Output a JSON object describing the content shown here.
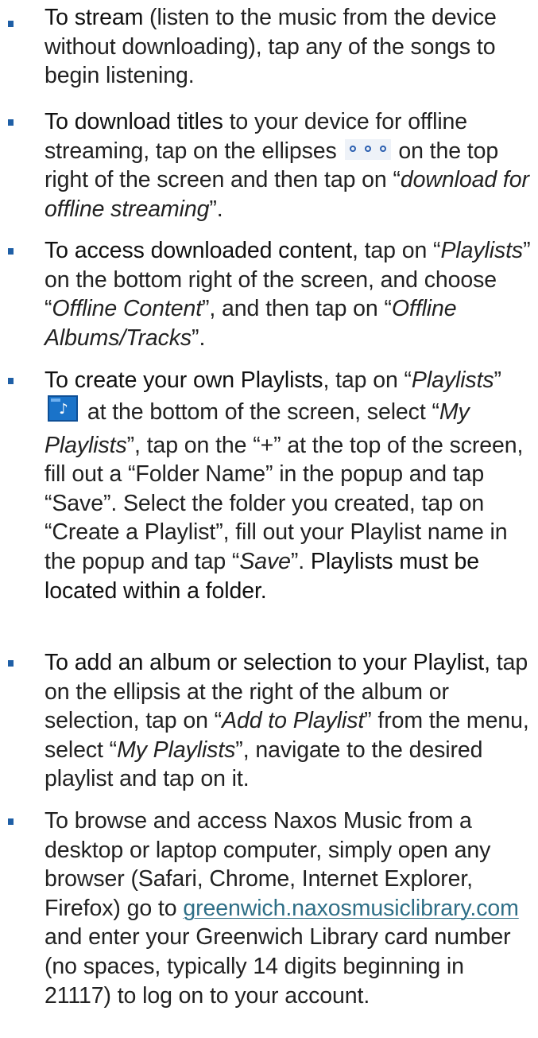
{
  "items": [
    {
      "lead": "To stream",
      "text_1": " (listen to the music from the device without downloading), tap any of the songs to begin listening."
    },
    {
      "lead": "To download titles",
      "text_1": " to your device for offline streaming, tap on the ellipses ",
      "icon": "more-options-ellipsis-icon",
      "text_2": " on the top right of the screen and then tap on “",
      "italic_1": "download for offline streaming",
      "text_3": "”."
    },
    {
      "lead": "To access downloaded content",
      "text_1": ", tap on “",
      "italic_1": "Playlists",
      "text_2": "” on the bottom right of the screen, and choose “",
      "italic_2": "Offline Content",
      "text_3": "”, and then tap on “",
      "italic_3": "Offline Albums/Tracks",
      "text_4": "”."
    },
    {
      "lead": "To create your own Playlists",
      "text_1": ", tap on “",
      "italic_1": "Playlists",
      "text_2": "” ",
      "icon": "playlist-folder-music-icon",
      "text_3": " at the bottom of the screen, select “",
      "italic_2": "My Playlists",
      "text_4": "”, tap on the “+” at the top of the screen, fill out a “Folder Name” in the popup and tap “Save”. Select the folder you created, tap on “Create a Playlist”, fill out your Playlist name in the popup and tap “",
      "italic_3": "Save",
      "text_5": "”. ",
      "emphasis": "Playlists must be located within a folder."
    },
    {
      "lead": "To add an album or selection to your Playlist,",
      "text_1": " tap on the ellipsis at the right of the album or selection, tap on “",
      "italic_1": "Add to Playlist",
      "text_2": "” from the menu, select “",
      "italic_2": "My Playlists",
      "text_3": "”, navigate to the desired playlist and tap on it."
    },
    {
      "text_1": "To browse and access Naxos Music from a desktop or laptop computer, simply open any browser (Safari, Chrome, Internet Explorer, Firefox) go to ",
      "link": "greenwich.naxosmusiclibrary.com",
      "text_2": " and enter your Greenwich Library card number (no spaces, typically 14 digits beginning in 21117) to log on to your account."
    }
  ],
  "colors": {
    "bullet": "#1f5fa6",
    "link": "#2f6f87",
    "playlist_icon": "#1a73c9",
    "ellipsis_icon": "#2b5fb0"
  }
}
